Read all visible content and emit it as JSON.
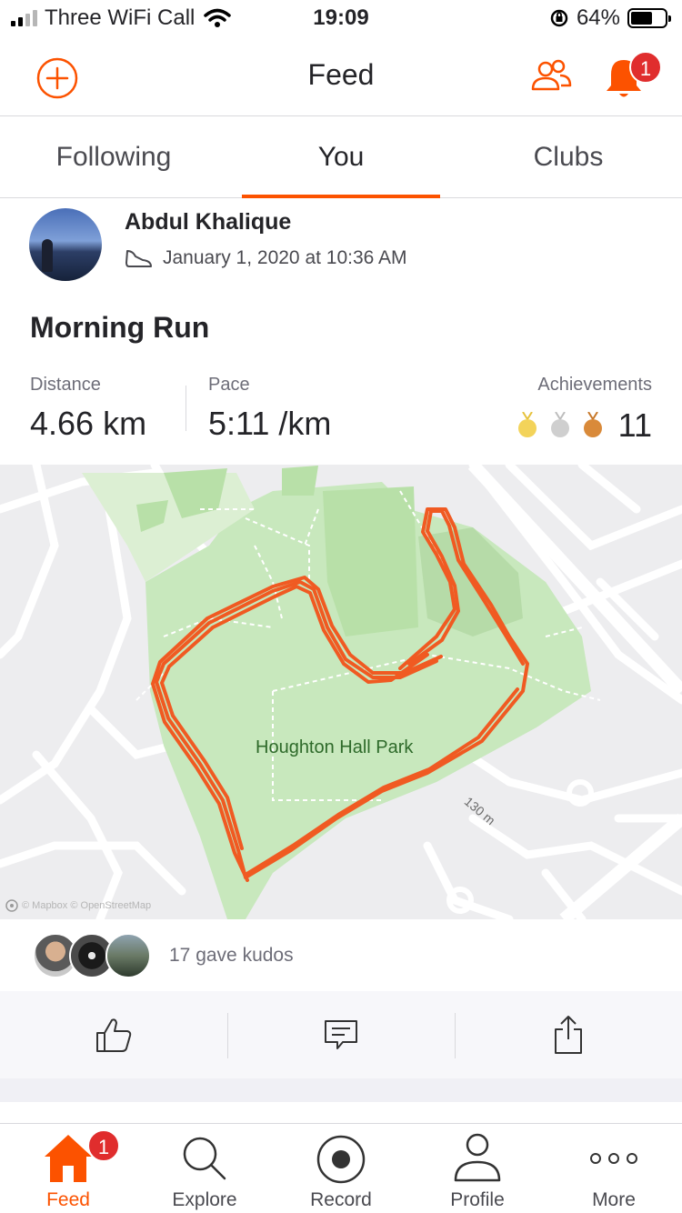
{
  "status_bar": {
    "carrier": "Three WiFi Call",
    "time": "19:09",
    "battery": "64%",
    "battery_level": 0.64
  },
  "header": {
    "title": "Feed",
    "notification_count": "1"
  },
  "tabs": [
    {
      "label": "Following",
      "active": false
    },
    {
      "label": "You",
      "active": true
    },
    {
      "label": "Clubs",
      "active": false
    }
  ],
  "activity": {
    "athlete": "Abdul Khalique",
    "datetime": "January 1, 2020 at 10:36 AM",
    "title": "Morning Run",
    "stats": {
      "distance_label": "Distance",
      "distance_value": "4.66 km",
      "pace_label": "Pace",
      "pace_value": "5:11 /km",
      "achievements_label": "Achievements",
      "achievements_count": "11"
    },
    "map": {
      "park_label": "Houghton Hall Park",
      "scale_label": "130 m",
      "attribution": "© Mapbox © OpenStreetMap"
    },
    "kudos_text": "17 gave kudos"
  },
  "colors": {
    "accent": "#fc5200",
    "badge": "#e02d2d",
    "park": "#c8e8bd",
    "route": "#f05a22"
  },
  "bottom_nav": [
    {
      "label": "Feed",
      "icon": "home-icon",
      "active": true,
      "badge": "1"
    },
    {
      "label": "Explore",
      "icon": "search-icon",
      "active": false
    },
    {
      "label": "Record",
      "icon": "record-icon",
      "active": false
    },
    {
      "label": "Profile",
      "icon": "profile-icon",
      "active": false
    },
    {
      "label": "More",
      "icon": "more-icon",
      "active": false
    }
  ]
}
